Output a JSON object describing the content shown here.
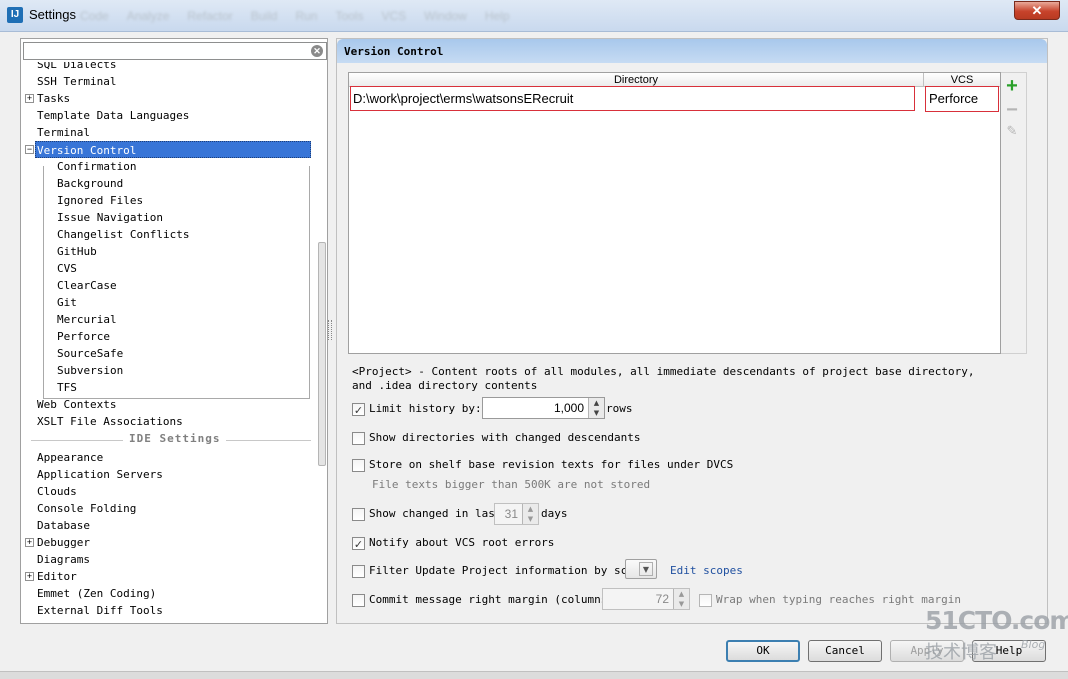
{
  "window": {
    "title": "Settings",
    "app_icon": "intellij-icon",
    "ghost_menu": [
      "Code",
      "Analyze",
      "Refactor",
      "Build",
      "Run",
      "Tools",
      "VCS",
      "Window",
      "Help"
    ],
    "close_glyph": "✕"
  },
  "sidebar": {
    "search_value": "",
    "items": [
      {
        "label": "SQL Dialects",
        "level": 0
      },
      {
        "label": "SSH Terminal",
        "level": 0
      },
      {
        "label": "Tasks",
        "level": 0,
        "expander": "+"
      },
      {
        "label": "Template Data Languages",
        "level": 0
      },
      {
        "label": "Terminal",
        "level": 0
      },
      {
        "label": "Version Control",
        "level": 0,
        "expander": "−",
        "selected": true
      },
      {
        "label": "Confirmation",
        "level": 1
      },
      {
        "label": "Background",
        "level": 1
      },
      {
        "label": "Ignored Files",
        "level": 1
      },
      {
        "label": "Issue Navigation",
        "level": 1
      },
      {
        "label": "Changelist Conflicts",
        "level": 1
      },
      {
        "label": "GitHub",
        "level": 1
      },
      {
        "label": "CVS",
        "level": 1
      },
      {
        "label": "ClearCase",
        "level": 1
      },
      {
        "label": "Git",
        "level": 1
      },
      {
        "label": "Mercurial",
        "level": 1
      },
      {
        "label": "Perforce",
        "level": 1
      },
      {
        "label": "SourceSafe",
        "level": 1
      },
      {
        "label": "Subversion",
        "level": 1
      },
      {
        "label": "TFS",
        "level": 1
      },
      {
        "label": "Web Contexts",
        "level": 0
      },
      {
        "label": "XSLT File Associations",
        "level": 0
      }
    ],
    "section_label": "IDE Settings",
    "ide_items": [
      {
        "label": "Appearance"
      },
      {
        "label": "Application Servers"
      },
      {
        "label": "Clouds"
      },
      {
        "label": "Console Folding"
      },
      {
        "label": "Database"
      },
      {
        "label": "Debugger",
        "expander": "+"
      },
      {
        "label": "Diagrams"
      },
      {
        "label": "Editor",
        "expander": "+"
      },
      {
        "label": "Emmet (Zen Coding)"
      },
      {
        "label": "External Diff Tools"
      }
    ]
  },
  "panel": {
    "title": "Version Control",
    "table": {
      "col_directory": "Directory",
      "col_vcs": "VCS",
      "rows": [
        {
          "directory": "D:\\work\\project\\erms\\watsonsERecruit",
          "vcs": "Perforce"
        }
      ]
    },
    "toolbar": {
      "add": "+",
      "remove": "−",
      "edit": "✎"
    },
    "hint": "<Project> - Content roots of all modules, all immediate descendants of project base directory, and .idea directory contents",
    "limit_history": {
      "label": "Limit history by:",
      "checked": true,
      "value": "1,000",
      "suffix": "rows"
    },
    "show_dirs": {
      "label": "Show directories with changed descendants",
      "checked": false
    },
    "store_shelf": {
      "label": "Store on shelf base revision texts for files under DVCS",
      "checked": false
    },
    "store_shelf_note": "File texts bigger than 500K are not stored",
    "show_changed": {
      "label": "Show changed in last",
      "checked": false,
      "value": "31",
      "suffix": "days"
    },
    "notify_vcs": {
      "label": "Notify about VCS root errors",
      "checked": true
    },
    "filter_update": {
      "label": "Filter Update Project information by scope",
      "checked": false,
      "link": "Edit scopes"
    },
    "commit_margin": {
      "label": "Commit message right margin (columns):",
      "checked": false,
      "value": "72"
    },
    "wrap_typing": {
      "label": "Wrap when typing reaches right margin",
      "checked": false
    }
  },
  "buttons": {
    "ok": "OK",
    "cancel": "Cancel",
    "apply": "Apply",
    "help": "Help"
  },
  "watermark": {
    "big": "51CTO.com",
    "small": "技术博客",
    "blog": "Blog"
  },
  "colors": {
    "selection": "#3875d7",
    "highlight_border": "#d8303a",
    "add_icon": "#2aa02a",
    "link": "#2050a0"
  }
}
